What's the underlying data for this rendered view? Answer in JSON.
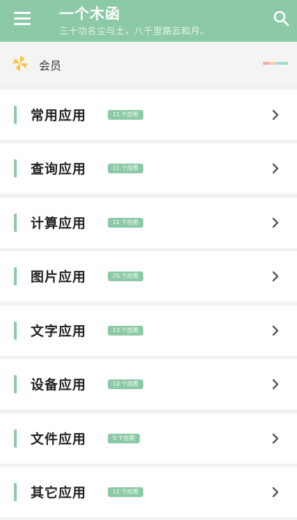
{
  "header": {
    "title": "一个木函",
    "subtitle": "三十功名尘与土，八千里路云和月。",
    "menu_icon": "hamburger-menu-icon",
    "search_icon": "search-icon",
    "background": "#8cc9a7"
  },
  "member": {
    "label": "会员",
    "icon": "pinwheel-icon",
    "rainbow_colors": [
      "#f7a6b1",
      "#f3d49b",
      "#a7d7e8",
      "#9fdcb9"
    ]
  },
  "categories": [
    {
      "title": "常用应用",
      "count": "11 个应用"
    },
    {
      "title": "查询应用",
      "count": "11 个应用"
    },
    {
      "title": "计算应用",
      "count": "11 个应用"
    },
    {
      "title": "图片应用",
      "count": "25 个应用"
    },
    {
      "title": "文字应用",
      "count": "13 个应用"
    },
    {
      "title": "设备应用",
      "count": "10 个应用"
    },
    {
      "title": "文件应用",
      "count": "5 个应用"
    },
    {
      "title": "其它应用",
      "count": "11 个应用"
    }
  ],
  "accent_color": "#8cc9a7"
}
